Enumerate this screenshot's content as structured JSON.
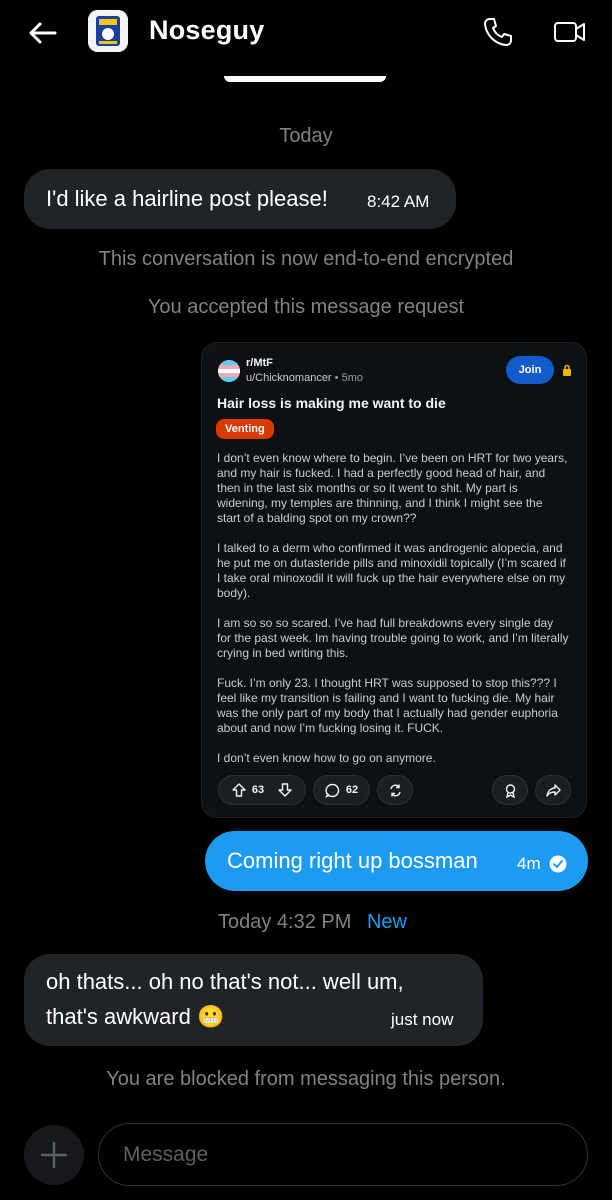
{
  "header": {
    "title": "Noseguy"
  },
  "thread": {
    "date_divider": "Today",
    "incoming_1": {
      "text": "I'd like a hairline post please!",
      "time": "8:42 AM"
    },
    "encrypted_notice": "This conversation is now end-to-end encrypted",
    "accepted_notice": "You accepted this message request",
    "shared_post": {
      "subreddit": "r/MtF",
      "user": "u/Chicknomancer",
      "age": "5mo",
      "join_label": "Join",
      "title": "Hair loss is making me want to die",
      "flair": "Venting",
      "paragraphs": [
        "I don’t even know where to begin. I’ve been on HRT for two years, and my hair is fucked. I had a perfectly good head of hair, and then in the last six months or so it went to shit. My part is widening, my temples are thinning, and I think I might see the start of a balding spot on my crown??",
        "I talked to a derm who confirmed it was androgenic alopecia, and he put me on dutasteride pills and minoxidil topically (I’m scared if I take oral minoxodil it will fuck up the hair everywhere else on my body).",
        "I am so so so scared. I’ve had full breakdowns every single day for the past week. Im having trouble going to work, and I’m literally crying in bed writing this.",
        "Fuck. I’m only 23. I thought HRT was supposed to stop this??? I feel like my transition is failing and I want to fucking die. My hair was the only part of my body that I actually had gender euphoria about and now I’m fucking losing it. FUCK.",
        "I don’t even know how to go on anymore."
      ],
      "upvotes": "63",
      "comments": "62"
    },
    "outgoing_1": {
      "text": "Coming right up bossman",
      "time": "4m"
    },
    "time_divider": "Today 4:32 PM",
    "new_label": "New",
    "incoming_2": {
      "line1": "oh thats... oh no that's not... well um,",
      "line2": "that's awkward",
      "emoji": "😬",
      "time": "just now"
    },
    "blocked_notice": "You are blocked from messaging this person."
  },
  "composer": {
    "placeholder": "Message"
  },
  "colors": {
    "accent": "#1d9bf0",
    "incoming_bubble": "#202327",
    "reddit_join": "#115bca",
    "flair": "#d93a00"
  },
  "icons": [
    "back-arrow-icon",
    "phone-icon",
    "video-icon",
    "lock-icon",
    "upvote-icon",
    "downvote-icon",
    "comment-icon",
    "share-icon",
    "award-icon",
    "sent-check-icon",
    "plus-icon"
  ]
}
